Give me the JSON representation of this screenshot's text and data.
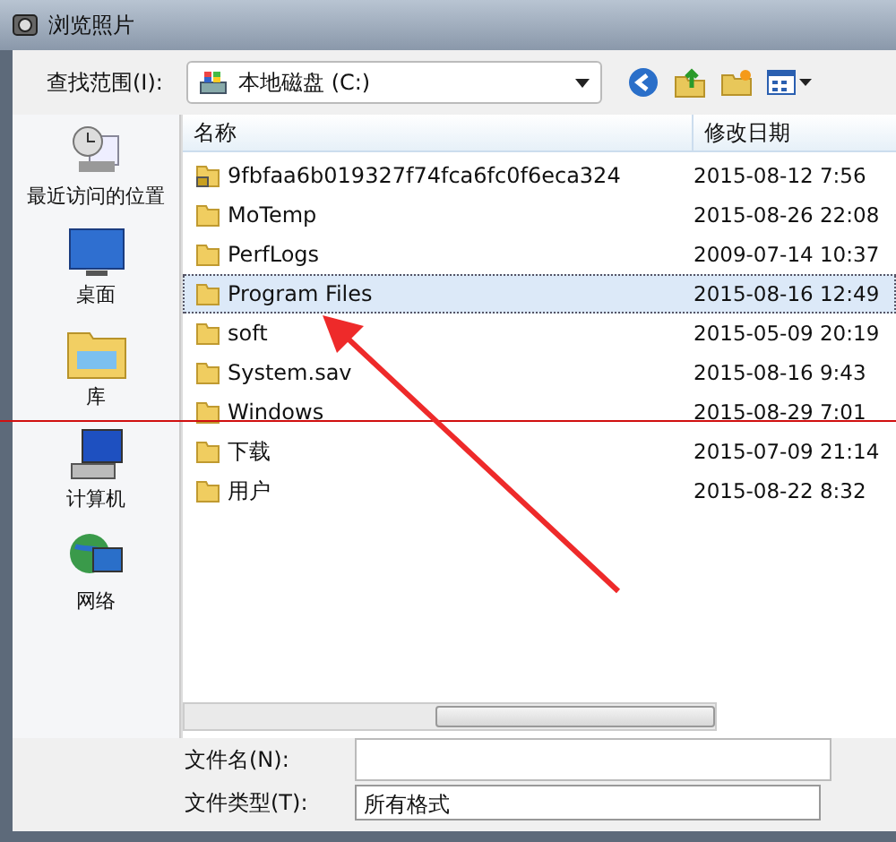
{
  "window": {
    "title": "浏览照片"
  },
  "look_in": {
    "label": "查找范围(I):",
    "value": "本地磁盘 (C:)"
  },
  "places": [
    {
      "kind": "recent",
      "label": "最近访问的位置"
    },
    {
      "kind": "desktop",
      "label": "桌面"
    },
    {
      "kind": "library",
      "label": "库"
    },
    {
      "kind": "computer",
      "label": "计算机"
    },
    {
      "kind": "network",
      "label": "网络"
    }
  ],
  "table": {
    "columns": [
      "名称",
      "修改日期"
    ],
    "rows": [
      {
        "kind": "locked-folder",
        "name": "9fbfaa6b019327f74fca6fc0f6eca324",
        "date": "2015-08-12 7:56",
        "selected": false
      },
      {
        "kind": "folder",
        "name": "MoTemp",
        "date": "2015-08-26 22:08",
        "selected": false
      },
      {
        "kind": "folder",
        "name": "PerfLogs",
        "date": "2009-07-14 10:37",
        "selected": false
      },
      {
        "kind": "folder",
        "name": "Program Files",
        "date": "2015-08-16 12:49",
        "selected": true
      },
      {
        "kind": "folder",
        "name": "soft",
        "date": "2015-05-09 20:19",
        "selected": false
      },
      {
        "kind": "folder",
        "name": "System.sav",
        "date": "2015-08-16 9:43",
        "selected": false
      },
      {
        "kind": "folder",
        "name": "Windows",
        "date": "2015-08-29 7:01",
        "selected": false
      },
      {
        "kind": "folder",
        "name": "下载",
        "date": "2015-07-09 21:14",
        "selected": false
      },
      {
        "kind": "folder",
        "name": "用户",
        "date": "2015-08-22 8:32",
        "selected": false
      }
    ]
  },
  "file_name": {
    "label": "文件名(N):"
  },
  "file_type": {
    "label": "文件类型(T):",
    "value": "所有格式"
  }
}
